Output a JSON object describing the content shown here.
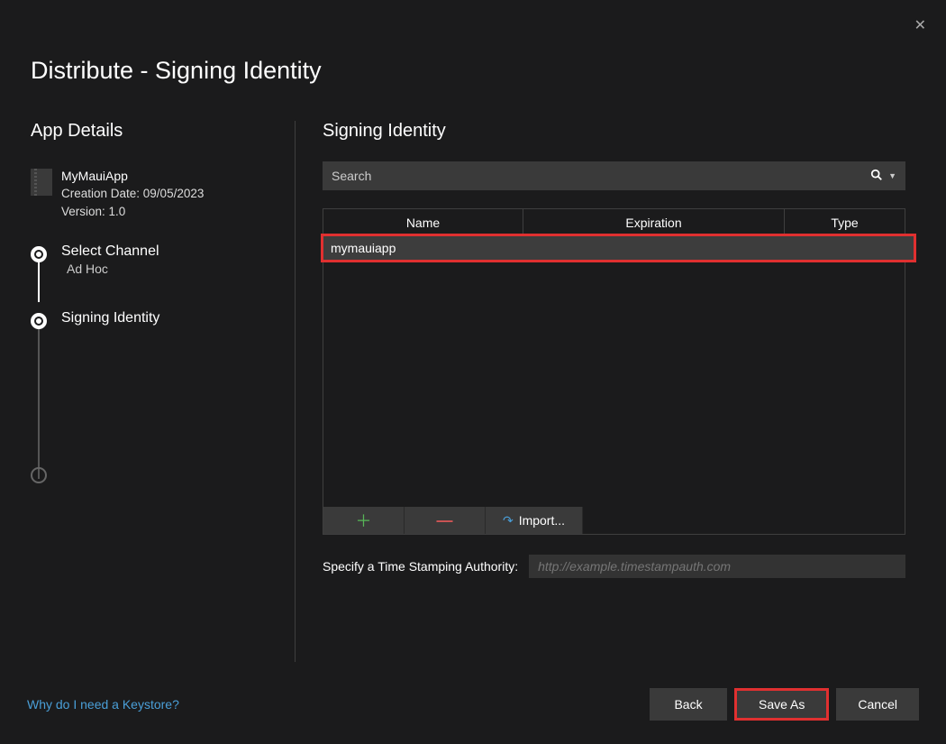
{
  "dialog": {
    "title": "Distribute - Signing Identity",
    "close_symbol": "✕"
  },
  "left": {
    "section_header": "App Details",
    "app_name": "MyMauiApp",
    "creation_label": "Creation Date: 09/05/2023",
    "version_label": "Version: 1.0",
    "steps": [
      {
        "title": "Select Channel",
        "sub": "Ad Hoc"
      },
      {
        "title": "Signing Identity"
      }
    ]
  },
  "right": {
    "title": "Signing Identity",
    "search_placeholder": "Search",
    "columns": {
      "name": "Name",
      "expiration": "Expiration",
      "type": "Type"
    },
    "rows": [
      {
        "name": "mymauiapp",
        "expiration": "",
        "type": ""
      }
    ],
    "toolbar": {
      "add_glyph": "＋",
      "remove_glyph": "—",
      "import_label": "Import..."
    },
    "timestamp_label": "Specify a Time Stamping Authority:",
    "timestamp_placeholder": "http://example.timestampauth.com"
  },
  "footer": {
    "help_link": "Why do I need a Keystore?",
    "back": "Back",
    "save_as": "Save As",
    "cancel": "Cancel"
  }
}
